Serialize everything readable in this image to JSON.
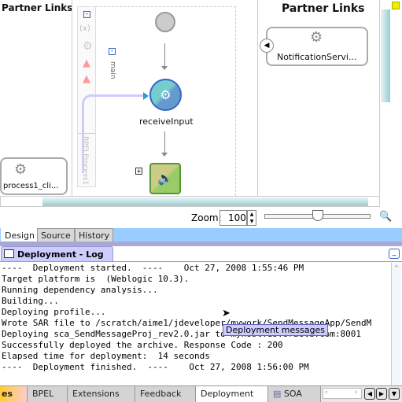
{
  "canvas": {
    "left_partner_links": "Partner Links",
    "right_partner_links": "Partner Links",
    "left_service": "process1_cli...",
    "right_service": "NotificationServi...",
    "scope_label": "main",
    "process_label": "BPELProcess1",
    "receive_activity": "receiveInput"
  },
  "zoom": {
    "label": "Zoom:",
    "value": "100",
    "slider_level": 0.5
  },
  "editor_tabs": [
    {
      "label": "Design"
    },
    {
      "label": "Source"
    },
    {
      "label": "History"
    }
  ],
  "log": {
    "title": "Deployment - Log",
    "lines": [
      "----  Deployment started.  ----    Oct 27, 2008 1:55:46 PM",
      "Target platform is  (Weblogic 10.3).",
      "Running dependency analysis...",
      "Building...",
      "Deploying profile...",
      "Wrote SAR file to /scratch/aime1/jdeveloper/mywork/SendMessageApp/SendM",
      "Deploying sca_SendMessageProj_rev2.0.jar to myhost.us.oracle.com:8001",
      "Successfully deployed the archive. Response Code : 200",
      "Elapsed time for deployment:  14 seconds",
      "----  Deployment finished.  ----    Oct 27, 2008 1:56:00 PM"
    ],
    "tooltip": "Deployment messages"
  },
  "bottom_tabs": [
    {
      "label": "es"
    },
    {
      "label": "BPEL"
    },
    {
      "label": "Extensions"
    },
    {
      "label": "Feedback"
    },
    {
      "label": "Deployment"
    },
    {
      "label": "SOA"
    }
  ]
}
